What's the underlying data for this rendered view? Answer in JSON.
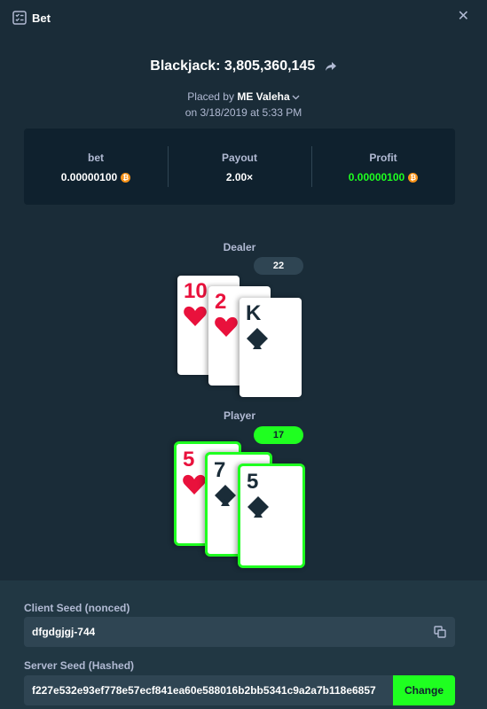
{
  "window": {
    "title": "Bet"
  },
  "header": {
    "title": "Blackjack: 3,805,360,145",
    "placed_prefix": "Placed by",
    "user": "ME Valeha",
    "date": "on 3/18/2019 at 5:33 PM"
  },
  "stats": {
    "bet_label": "bet",
    "bet_value": "0.00000100",
    "payout_label": "Payout",
    "payout_value": "2.00×",
    "profit_label": "Profit",
    "profit_value": "0.00000100",
    "currency_symbol": "₿",
    "profit_color": "#1fff20"
  },
  "dealer": {
    "label": "Dealer",
    "total": "22",
    "cards": [
      {
        "rank": "10",
        "suit": "hearts"
      },
      {
        "rank": "2",
        "suit": "hearts"
      },
      {
        "rank": "K",
        "suit": "spades"
      }
    ]
  },
  "player": {
    "label": "Player",
    "total": "17",
    "cards": [
      {
        "rank": "5",
        "suit": "hearts"
      },
      {
        "rank": "7",
        "suit": "spades"
      },
      {
        "rank": "5",
        "suit": "spades"
      }
    ]
  },
  "seeds": {
    "client_label": "Client Seed (nonced)",
    "client_value": "dfgdgjgj-744",
    "server_label": "Server Seed (Hashed)",
    "server_value": "f227e532e93ef778e57ecf841ea60e588016b2bb5341c9a2a7b118e6857",
    "change_label": "Change"
  },
  "colors": {
    "background": "#1a2c38",
    "panel": "#0f212e",
    "accent_green": "#1fff20",
    "red_suit": "#e9113c"
  }
}
